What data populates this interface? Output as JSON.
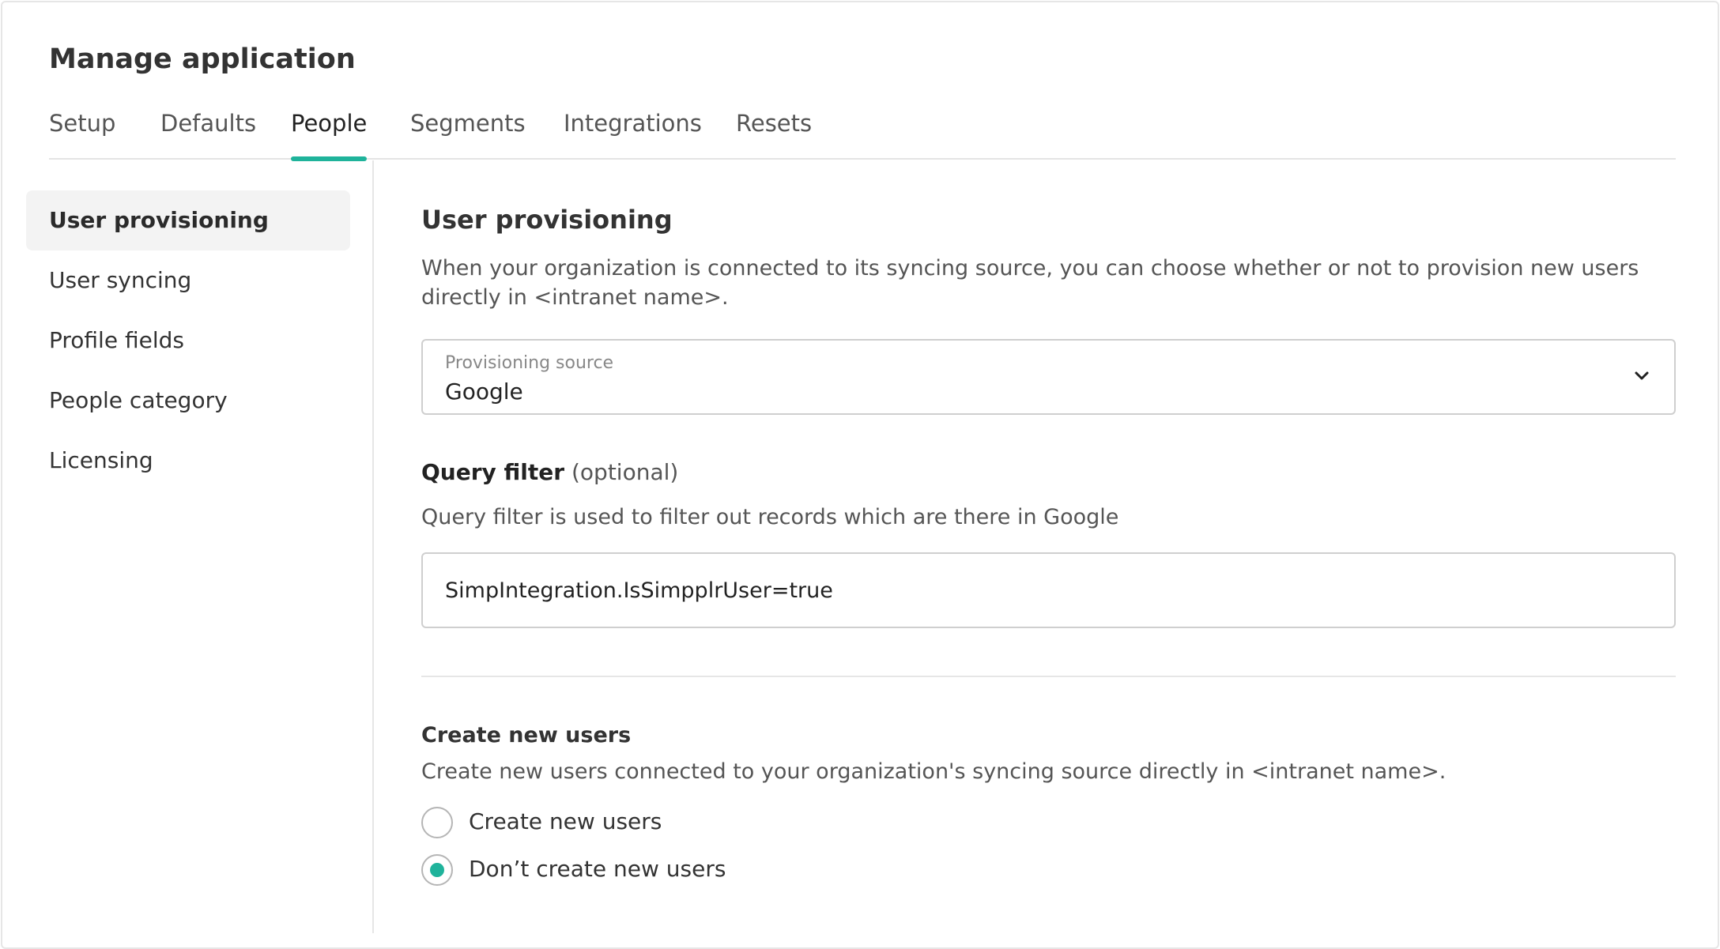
{
  "page": {
    "title": "Manage application"
  },
  "tabs": [
    {
      "label": "Setup"
    },
    {
      "label": "Defaults"
    },
    {
      "label": "People"
    },
    {
      "label": "Segments"
    },
    {
      "label": "Integrations"
    },
    {
      "label": "Resets"
    }
  ],
  "active_tab": "People",
  "sidebar": {
    "items": [
      {
        "label": "User provisioning"
      },
      {
        "label": "User syncing"
      },
      {
        "label": "Profile fields"
      },
      {
        "label": "People category"
      },
      {
        "label": "Licensing"
      }
    ],
    "active_item": "User provisioning"
  },
  "main": {
    "title": "User provisioning",
    "description": "When your organization is connected to its syncing source, you can choose whether or not to provision new users directly in <intranet name>.",
    "provisioning_source": {
      "label": "Provisioning source",
      "value": "Google",
      "icon": "chevron-down-icon"
    },
    "query_filter": {
      "label": "Query filter",
      "optional": "(optional)",
      "description": "Query filter is used to filter out records which are there in Google",
      "value": "SimpIntegration.IsSimpplrUser=true"
    },
    "create_new_users": {
      "title": "Create new users",
      "description": "Create new users connected to your organization's syncing source directly in <intranet name>.",
      "options": [
        {
          "label": "Create new users",
          "checked": false
        },
        {
          "label": "Don’t create new users",
          "checked": true
        }
      ]
    }
  },
  "colors": {
    "accent": "#1fb39b",
    "border": "#cfcfcf",
    "active_sidebar_bg": "#f3f3f3"
  }
}
